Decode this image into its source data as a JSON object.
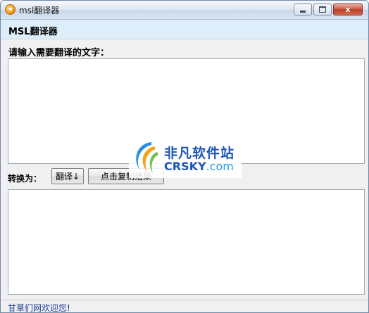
{
  "window": {
    "title": "msl翻译器",
    "icon": "app-logo-icon",
    "controls": {
      "minimize": "minimize-icon",
      "maximize": "maximize-icon",
      "close_glyph": "x"
    }
  },
  "header": {
    "title": "MSL翻译器"
  },
  "input": {
    "label": "请输入需要翻译的文字：",
    "value": ""
  },
  "convert": {
    "label": "转换为：",
    "translate_button": "翻译↓",
    "copy_button": "点击复制结果"
  },
  "output": {
    "value": ""
  },
  "watermark": {
    "cn": "非凡软件站",
    "en_main": "CRSKY",
    "en_domain": ".com"
  },
  "status": {
    "text": "甘草们网欢迎您!"
  },
  "colors": {
    "header_band": "#ddeefa",
    "status_text": "#1f3f9a",
    "watermark": "#1c56b8"
  }
}
